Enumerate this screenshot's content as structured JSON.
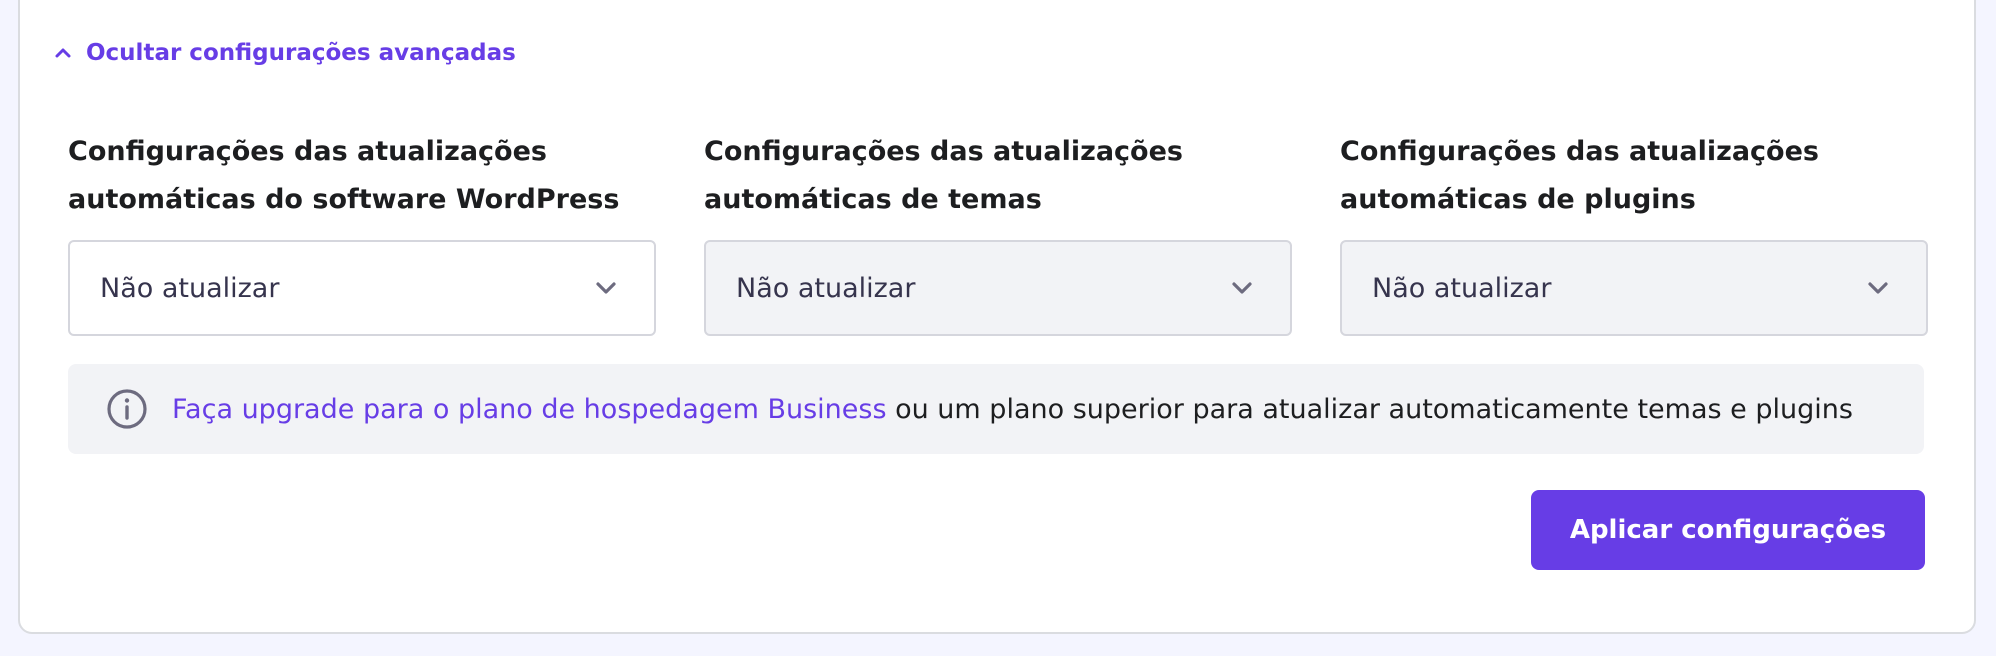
{
  "advanced": {
    "toggle_label": "Ocultar configurações avançadas",
    "toggle_icon": "chevron-up-icon"
  },
  "columns": [
    {
      "label_line1": "Configurações das atualizações",
      "label_line2": "automáticas do software WordPress",
      "select_value": "Não atualizar",
      "enabled": true
    },
    {
      "label_line1": "Configurações das atualizações",
      "label_line2": "automáticas de temas",
      "select_value": "Não atualizar",
      "enabled": false
    },
    {
      "label_line1": "Configurações das atualizações",
      "label_line2": "automáticas de plugins",
      "select_value": "Não atualizar",
      "enabled": false
    }
  ],
  "notice": {
    "icon": "info-icon",
    "link_text": "Faça upgrade para o plano de hospedagem Business",
    "rest_text": " ou um plano superior para atualizar automaticamente temas e plugins"
  },
  "actions": {
    "apply_label": "Aplicar configurações"
  },
  "colors": {
    "accent": "#673de6",
    "page_background": "#f4f5ff",
    "disabled_field": "#f2f3f6",
    "text": "#1d1e20"
  }
}
